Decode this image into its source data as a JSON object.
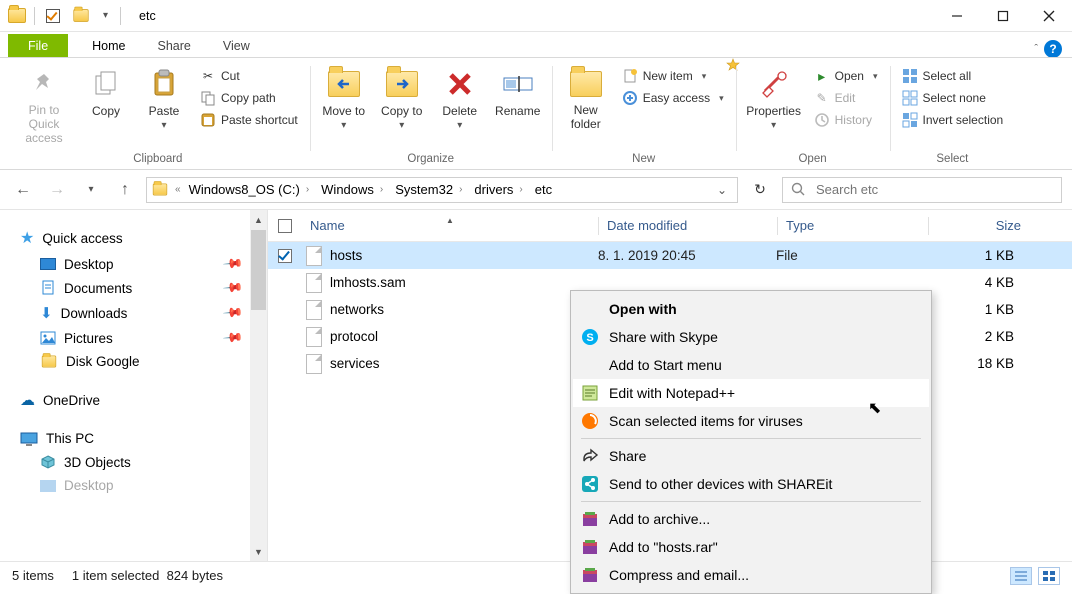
{
  "window": {
    "title": "etc"
  },
  "tabs": {
    "file": "File",
    "home": "Home",
    "share": "Share",
    "view": "View"
  },
  "ribbon": {
    "clipboard": {
      "label": "Clipboard",
      "pin": "Pin to Quick access",
      "copy": "Copy",
      "paste": "Paste",
      "cut": "Cut",
      "copy_path": "Copy path",
      "paste_shortcut": "Paste shortcut"
    },
    "organize": {
      "label": "Organize",
      "move_to": "Move to",
      "copy_to": "Copy to",
      "delete": "Delete",
      "rename": "Rename"
    },
    "new": {
      "label": "New",
      "new_folder": "New folder",
      "new_item": "New item",
      "easy_access": "Easy access"
    },
    "open": {
      "label": "Open",
      "properties": "Properties",
      "open": "Open",
      "edit": "Edit",
      "history": "History"
    },
    "select": {
      "label": "Select",
      "select_all": "Select all",
      "select_none": "Select none",
      "invert": "Invert selection"
    }
  },
  "breadcrumb": [
    "Windows8_OS (C:)",
    "Windows",
    "System32",
    "drivers",
    "etc"
  ],
  "search": {
    "placeholder": "Search etc"
  },
  "columns": {
    "name": "Name",
    "date": "Date modified",
    "type": "Type",
    "size": "Size"
  },
  "sidebar": {
    "quick_access": "Quick access",
    "items": [
      {
        "icon": "desktop",
        "label": "Desktop",
        "pinned": true
      },
      {
        "icon": "documents",
        "label": "Documents",
        "pinned": true
      },
      {
        "icon": "downloads",
        "label": "Downloads",
        "pinned": true
      },
      {
        "icon": "pictures",
        "label": "Pictures",
        "pinned": true
      },
      {
        "icon": "folder",
        "label": "Disk Google",
        "pinned": false
      }
    ],
    "onedrive": "OneDrive",
    "this_pc": "This PC",
    "pc_items": [
      {
        "icon": "3d",
        "label": "3D Objects"
      },
      {
        "icon": "desktop",
        "label": "Desktop"
      }
    ]
  },
  "files": [
    {
      "name": "hosts",
      "date": "8. 1. 2019 20:45",
      "type": "File",
      "size": "1 KB",
      "selected": true
    },
    {
      "name": "lmhosts.sam",
      "date": "",
      "type": "",
      "size": "4 KB",
      "selected": false
    },
    {
      "name": "networks",
      "date": "",
      "type": "",
      "size": "1 KB",
      "selected": false
    },
    {
      "name": "protocol",
      "date": "",
      "type": "",
      "size": "2 KB",
      "selected": false
    },
    {
      "name": "services",
      "date": "",
      "type": "",
      "size": "18 KB",
      "selected": false
    }
  ],
  "context_menu": {
    "open_with": "Open with",
    "share_skype": "Share with Skype",
    "add_start": "Add to Start menu",
    "edit_npp": "Edit with Notepad++",
    "scan_virus": "Scan selected items for viruses",
    "share": "Share",
    "send_shareit": "Send to other devices with SHAREit",
    "add_archive": "Add to archive...",
    "add_hosts_rar": "Add to \"hosts.rar\"",
    "compress_email": "Compress and email..."
  },
  "status": {
    "count": "5 items",
    "selected": "1 item selected",
    "bytes": "824 bytes"
  }
}
